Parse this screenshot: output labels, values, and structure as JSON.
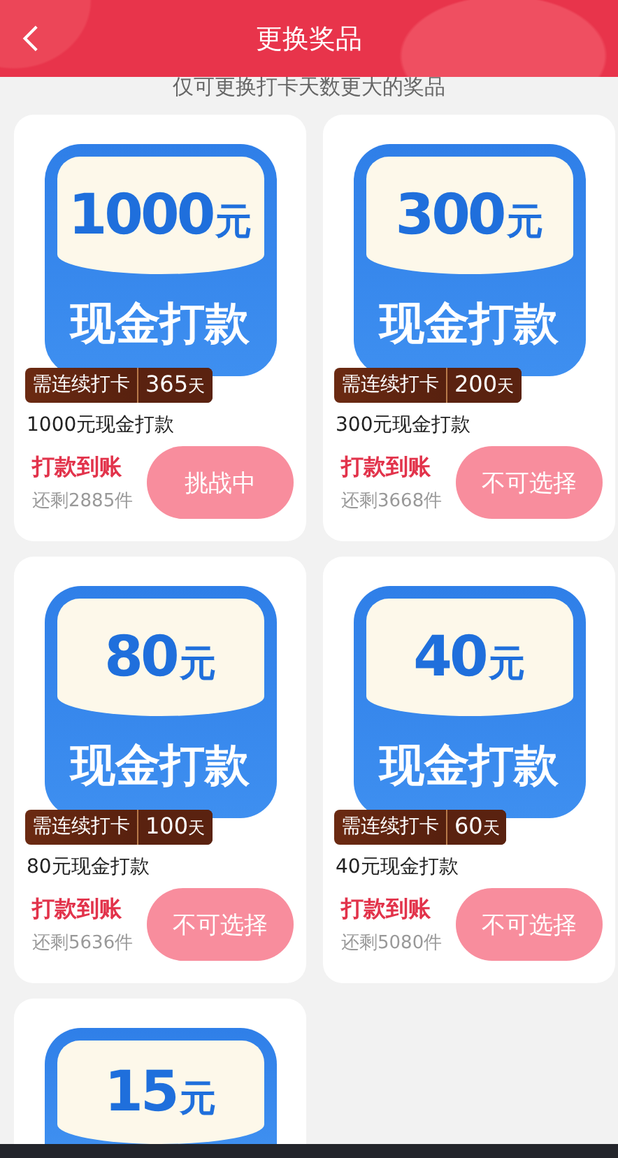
{
  "header": {
    "title": "更换奖品"
  },
  "subtitle": "仅可更换打卡天数更大的奖品",
  "prizes": [
    {
      "amount": "1000",
      "unit": "元",
      "label": "现金打款",
      "badge": "需连续打卡",
      "days": "365",
      "days_unit": "天",
      "name": "1000元现金打款",
      "delivery": "打款到账",
      "stock": "还剩2885件",
      "action": "挑战中"
    },
    {
      "amount": "300",
      "unit": "元",
      "label": "现金打款",
      "badge": "需连续打卡",
      "days": "200",
      "days_unit": "天",
      "name": "300元现金打款",
      "delivery": "打款到账",
      "stock": "还剩3668件",
      "action": "不可选择"
    },
    {
      "amount": "80",
      "unit": "元",
      "label": "现金打款",
      "badge": "需连续打卡",
      "days": "100",
      "days_unit": "天",
      "name": "80元现金打款",
      "delivery": "打款到账",
      "stock": "还剩5636件",
      "action": "不可选择"
    },
    {
      "amount": "40",
      "unit": "元",
      "label": "现金打款",
      "badge": "需连续打卡",
      "days": "60",
      "days_unit": "天",
      "name": "40元现金打款",
      "delivery": "打款到账",
      "stock": "还剩5080件",
      "action": "不可选择"
    },
    {
      "amount": "15",
      "unit": "元"
    }
  ]
}
